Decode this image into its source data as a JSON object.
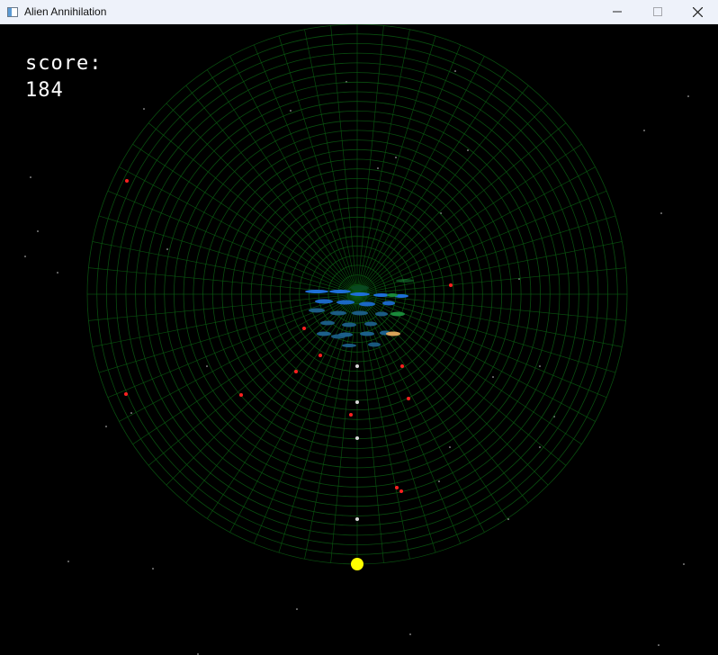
{
  "window": {
    "title": "Alien Annihilation",
    "icon": "app-window-icon",
    "controls": [
      "minimize-icon",
      "maximize-icon",
      "close-icon"
    ]
  },
  "hud": {
    "score_label": "score:",
    "score_value": "184"
  },
  "colors": {
    "background": "#000000",
    "grid": "#0b5a12",
    "player": "#ffff00",
    "enemy_bullet": "#ff2020",
    "player_bullet": "#d8d8d8",
    "alien_blue": "#1e6fd9",
    "alien_teal": "#1c5f8a",
    "alien_green": "#1a8a3a",
    "alien_tan": "#d9a35a",
    "star": "#cfcfcf"
  }
}
